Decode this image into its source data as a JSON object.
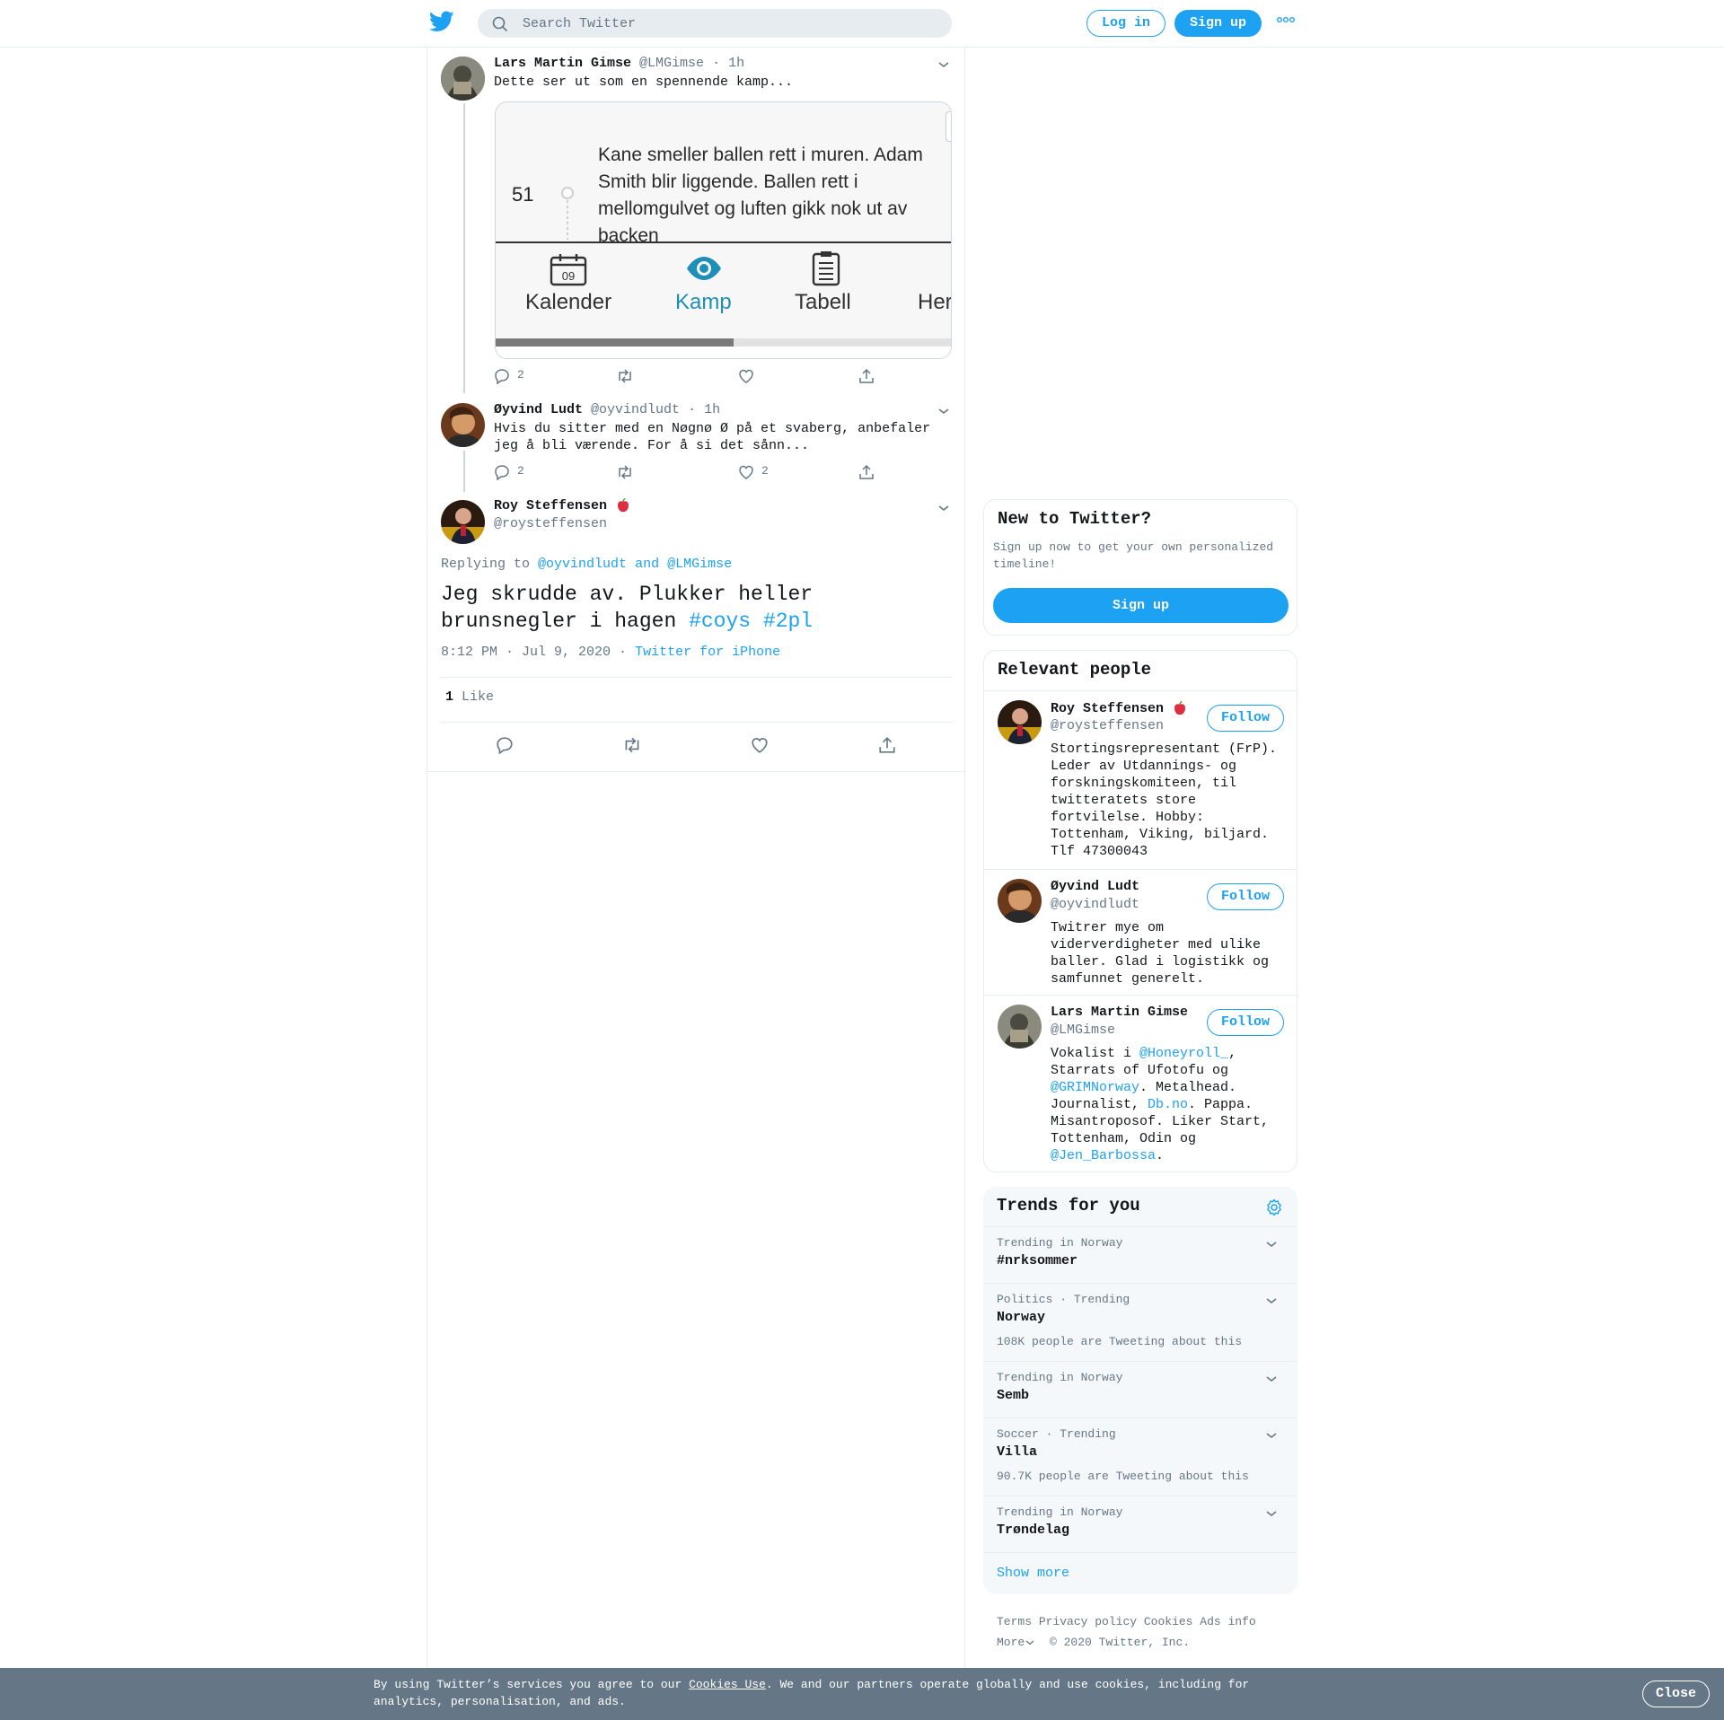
{
  "header": {
    "search_placeholder": "Search Twitter",
    "login_label": "Log in",
    "signup_label": "Sign up"
  },
  "tweets": [
    {
      "name": "Lars Martin Gimse",
      "handle": "@LMGimse",
      "time": "· 1h",
      "text": "Dette ser ut som en spennende kamp...",
      "reply_count": "2",
      "retweet_count": "",
      "like_count": ""
    },
    {
      "name": "Øyvind Ludt",
      "handle": "@oyvindludt",
      "time": "· 1h",
      "text": "Hvis du sitter med en Nøgnø Ø på et svaberg, anbefaler jeg å bli værende. For å si det sånn...",
      "reply_count": "2",
      "retweet_count": "",
      "like_count": "2"
    }
  ],
  "media": {
    "minute": "51",
    "commentary": "Kane smeller ballen rett i muren. Adam Smith blir liggende. Ballen rett i mellomgulvet og luften gikk nok ut av backen",
    "calendar_day": "09",
    "tabs": [
      "Kalender",
      "Kamp",
      "Tabell",
      "Her"
    ],
    "active_tab": "Kamp",
    "progress": 0.52
  },
  "main_tweet": {
    "name": "Roy Steffensen",
    "handle": "@roysteffensen",
    "replying_prefix": "Replying to",
    "replying_to": "@oyvindludt and @LMGimse",
    "text_plain": "Jeg skrudde av. Plukker heller brunsnegler i hagen",
    "hashtag1": "#coys",
    "hashtag2": "#2pl",
    "timestamp": "8:12 PM · Jul 9, 2020 ·",
    "source": "Twitter for iPhone",
    "like_count": "1",
    "like_label": "Like"
  },
  "sidebar": {
    "new_title": "New to Twitter?",
    "new_text": "Sign up now to get your own personalized timeline!",
    "signup_label": "Sign up",
    "relevant_title": "Relevant people",
    "follow_label": "Follow",
    "people": [
      {
        "name": "Roy Steffensen",
        "handle": "@roysteffensen",
        "bio": "Stortingsrepresentant (FrP). Leder av Utdannings- og forskningskomiteen, til twitteratets store fortvilelse. Hobby: Tottenham, Viking, biljard. Tlf 47300043"
      },
      {
        "name": "Øyvind Ludt",
        "handle": "@oyvindludt",
        "bio": "Twitrer mye om viderverdigheter med ulike baller. Glad i logistikk og samfunnet generelt."
      },
      {
        "name": "Lars Martin Gimse",
        "handle": "@LMGimse",
        "bio_parts": [
          "Vokalist i ",
          "@Honeyroll_",
          ", Starrats of Ufotofu og ",
          "@GRIMNorway",
          ". Metalhead. Journalist, ",
          "Db.no",
          ". Pappa. Misantroposof. Liker Start, Tottenham, Odin og ",
          "@Jen_Barbossa",
          "."
        ]
      }
    ],
    "trends_title": "Trends for you",
    "trends": [
      {
        "meta": "Trending in Norway",
        "name": "#nrksommer",
        "count": ""
      },
      {
        "meta": "Politics · Trending",
        "name": "Norway",
        "count": "108K people are Tweeting about this"
      },
      {
        "meta": "Trending in Norway",
        "name": "Semb",
        "count": ""
      },
      {
        "meta": "Soccer · Trending",
        "name": "Villa",
        "count": "90.7K people are Tweeting about this"
      },
      {
        "meta": "Trending in Norway",
        "name": "Trøndelag",
        "count": ""
      }
    ],
    "show_more": "Show more",
    "footer": {
      "terms": "Terms",
      "privacy": "Privacy policy",
      "cookies": "Cookies",
      "ads": "Ads info",
      "more": "More",
      "copyright": "© 2020 Twitter, Inc."
    }
  },
  "cookie_banner": {
    "text_before": "By using Twitter’s services you agree to our",
    "link": "Cookies Use",
    "text_after": ". We and our partners operate globally and use cookies, including for analytics, personalisation, and ads.",
    "close_label": "Close"
  },
  "colors": {
    "accent": "#1da1f2",
    "secondary_text": "#657786",
    "border": "#e6ecf0",
    "banner": "#657786"
  }
}
